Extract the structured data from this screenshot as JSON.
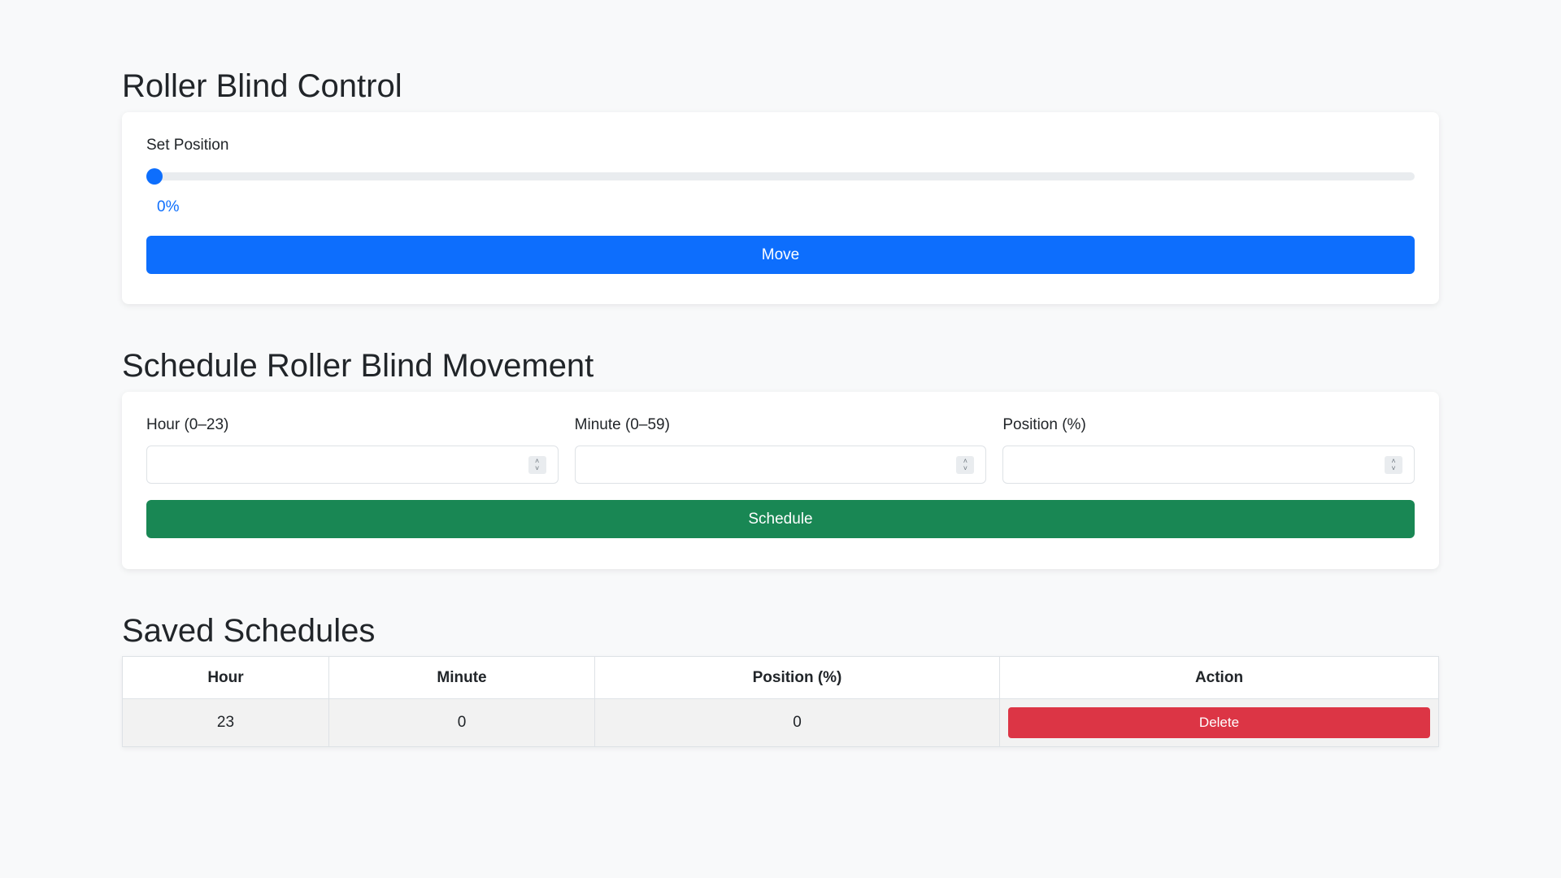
{
  "control": {
    "title": "Roller Blind Control",
    "label": "Set Position",
    "position_value": 0,
    "position_text": "0%",
    "move_label": "Move"
  },
  "schedule": {
    "title": "Schedule Roller Blind Movement",
    "hour_label": "Hour (0–23)",
    "minute_label": "Minute (0–59)",
    "position_label": "Position (%)",
    "hour_value": "",
    "minute_value": "",
    "position_value": "",
    "schedule_label": "Schedule"
  },
  "saved": {
    "title": "Saved Schedules",
    "columns": [
      "Hour",
      "Minute",
      "Position (%)",
      "Action"
    ],
    "rows": [
      {
        "hour": "23",
        "minute": "0",
        "position": "0",
        "action": "Delete"
      }
    ]
  },
  "colors": {
    "primary": "#0d6efd",
    "success": "#198754",
    "danger": "#dc3545",
    "background": "#f8f9fa"
  }
}
